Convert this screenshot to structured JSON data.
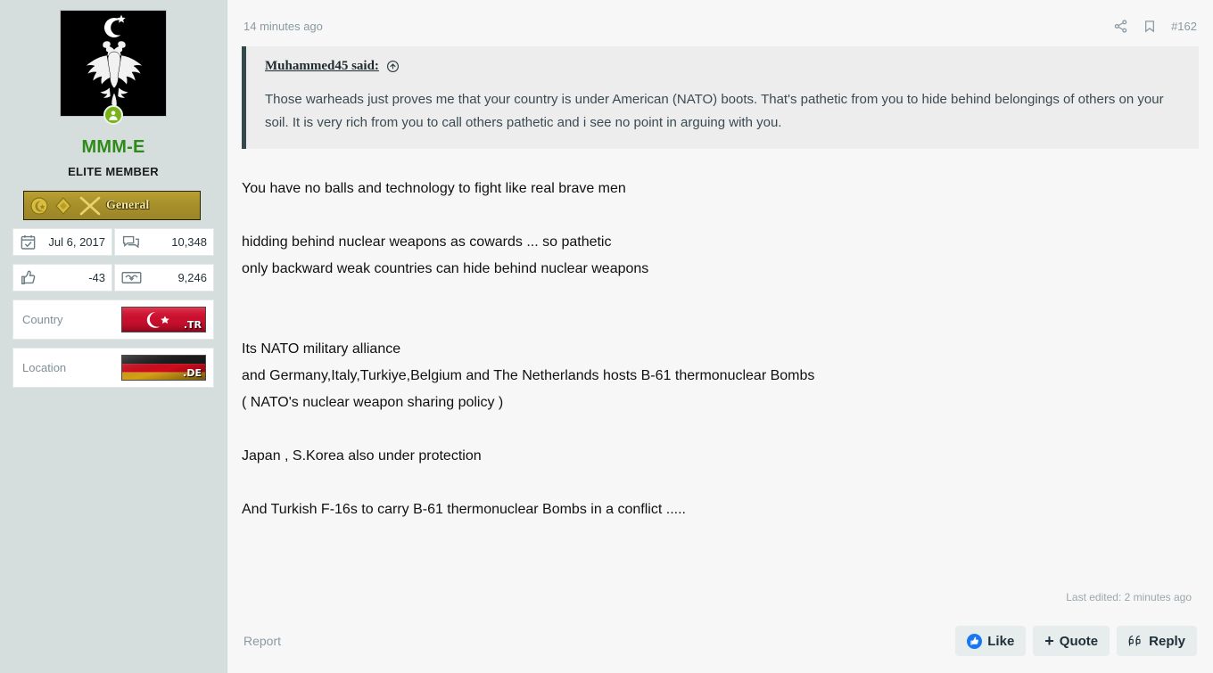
{
  "sidebar": {
    "avatar": {
      "icon": "double-headed-eagle-crescent-star-emblem",
      "online_status_icon": "online-user-badge"
    },
    "username": "MMM-E",
    "user_title": "ELITE MEMBER",
    "rank": {
      "label": "General",
      "icons": [
        "crescent-star-medal-icon",
        "diamond-medal-icon",
        "crossed-swords-icon"
      ]
    },
    "stats": [
      {
        "icon": "calendar-icon",
        "name": "joined-date",
        "value": "Jul 6, 2017"
      },
      {
        "icon": "messages-icon",
        "name": "messages-count",
        "value": "10,348"
      },
      {
        "icon": "thumbs-up-icon",
        "name": "reaction-score",
        "value": "-43"
      },
      {
        "icon": "handshake-icon",
        "name": "points-count",
        "value": "9,246"
      }
    ],
    "info": [
      {
        "label": "Country",
        "flag": "turkey-flag",
        "tld": ".TR"
      },
      {
        "label": "Location",
        "flag": "germany-flag",
        "tld": ".DE"
      }
    ]
  },
  "post": {
    "timestamp": "14 minutes ago",
    "share_icon": "share-icon",
    "bookmark_icon": "bookmark-icon",
    "post_number": "#162",
    "quote": {
      "author_label": "Muhammed45 said:",
      "jump_icon": "jump-to-post-arrow-icon",
      "text": "Those warheads just proves me that your country is under American (NATO) boots. That's pathetic from you to hide behind belongings of others on your soil. It is very rich from you to call others pathetic and i see no point in arguing with you."
    },
    "body": {
      "line1": "You have no balls and technology to fight like real brave men",
      "line2": "hidding behind nuclear weapons as cowards ... so pathetic",
      "line3": "only backward weak countries can hide behind nuclear weapons",
      "line4": "Its NATO military alliance",
      "line5": "and Germany,Italy,Turkiye,Belgium and The Netherlands hosts B-61 thermonuclear Bombs",
      "line6": "( NATO's nuclear weapon sharing policy )",
      "line7": "Japan , S.Korea also under protection",
      "line8": "And Turkish F-16s to carry B-61 thermonuclear Bombs in a conflict ....."
    },
    "last_edited": "Last edited: 2 minutes ago",
    "report_label": "Report",
    "actions": [
      {
        "name": "like",
        "label": "Like",
        "icon": "thumbs-up-filled-icon"
      },
      {
        "name": "quote",
        "label": "Quote",
        "icon": "plus-icon"
      },
      {
        "name": "reply",
        "label": "Reply",
        "icon": "quote-marks-icon"
      }
    ]
  },
  "colors": {
    "sidebar_bg": "#d6dedd",
    "content_bg": "#f7f7f7",
    "quote_bg": "#ededed",
    "quote_border": "#35484c",
    "username_green": "#2e8b18",
    "like_blue": "#1877f2",
    "rank_gold": "#a8902b"
  }
}
